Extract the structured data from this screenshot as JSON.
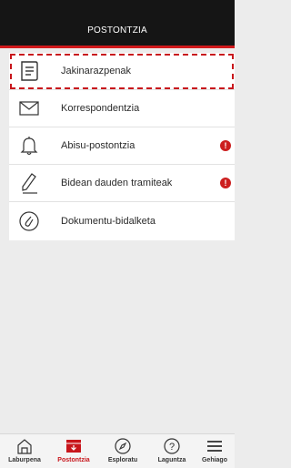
{
  "header": {
    "title": "POSTONTZIA"
  },
  "colors": {
    "accent": "#d0191b",
    "header_bg": "#151515",
    "badge": "#cc1f1f"
  },
  "menu": [
    {
      "label": "Jakinarazpenak",
      "icon": "notes-icon",
      "badge": ""
    },
    {
      "label": "Korrespondentzia",
      "icon": "envelope-icon",
      "badge": ""
    },
    {
      "label": "Abisu-postontzia",
      "icon": "bell-icon",
      "badge": "!"
    },
    {
      "label": "Bidean dauden tramiteak",
      "icon": "pencil-icon",
      "badge": "!"
    },
    {
      "label": "Dokumentu-bidalketa",
      "icon": "paperclip-icon",
      "badge": ""
    }
  ],
  "tabs": [
    {
      "label": "Laburpena",
      "icon": "home-icon"
    },
    {
      "label": "Postontzia",
      "icon": "mailbox-icon",
      "active": true
    },
    {
      "label": "Esploratu",
      "icon": "compass-icon"
    },
    {
      "label": "Laguntza",
      "icon": "help-icon"
    },
    {
      "label": "Gehiago",
      "icon": "menu-icon"
    }
  ]
}
